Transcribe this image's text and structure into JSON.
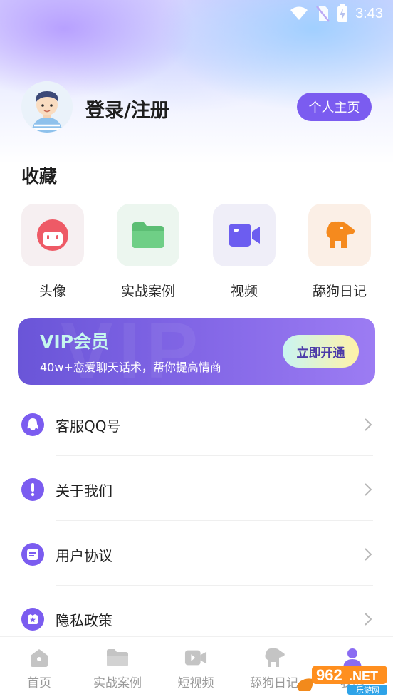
{
  "status_bar": {
    "time": "3:43"
  },
  "header": {
    "login_label": "登录/注册",
    "profile_button_label": "个人主页"
  },
  "favorites": {
    "title": "收藏",
    "items": [
      {
        "label": "头像",
        "icon": "avatar-face-icon",
        "tile_color": "#f6eff1",
        "icon_color": "#ee5a66"
      },
      {
        "label": "实战案例",
        "icon": "folder-icon",
        "tile_color": "#ecf6ef",
        "icon_color": "#5cbe74"
      },
      {
        "label": "视频",
        "icon": "video-camera-icon",
        "tile_color": "#efeef8",
        "icon_color": "#6c5df0"
      },
      {
        "label": "舔狗日记",
        "icon": "dog-icon",
        "tile_color": "#fbefe6",
        "icon_color": "#f58a1e"
      }
    ]
  },
  "vip": {
    "title": "VIP会员",
    "subtitle": "40w+恋爱聊天话术，帮你提高情商",
    "button_label": "立即开通",
    "watermark": "VIP"
  },
  "menu": [
    {
      "label": "客服QQ号",
      "icon": "qq-penguin-icon"
    },
    {
      "label": "关于我们",
      "icon": "info-exclamation-icon"
    },
    {
      "label": "用户协议",
      "icon": "document-icon"
    },
    {
      "label": "隐私政策",
      "icon": "shield-star-icon"
    }
  ],
  "tabbar": [
    {
      "label": "首页",
      "icon": "home-icon",
      "active": false
    },
    {
      "label": "实战案例",
      "icon": "folder-icon",
      "active": false
    },
    {
      "label": "短视频",
      "icon": "video-icon",
      "active": false
    },
    {
      "label": "舔狗日记",
      "icon": "dog-icon",
      "active": false
    },
    {
      "label": "我的",
      "icon": "person-icon",
      "active": true
    }
  ],
  "watermark": {
    "brand_number": "962",
    "brand_net": ".NET",
    "brand_cn": "乐游网"
  },
  "colors": {
    "accent": "#7b5cf0",
    "tab_inactive": "#9a9a9a"
  }
}
